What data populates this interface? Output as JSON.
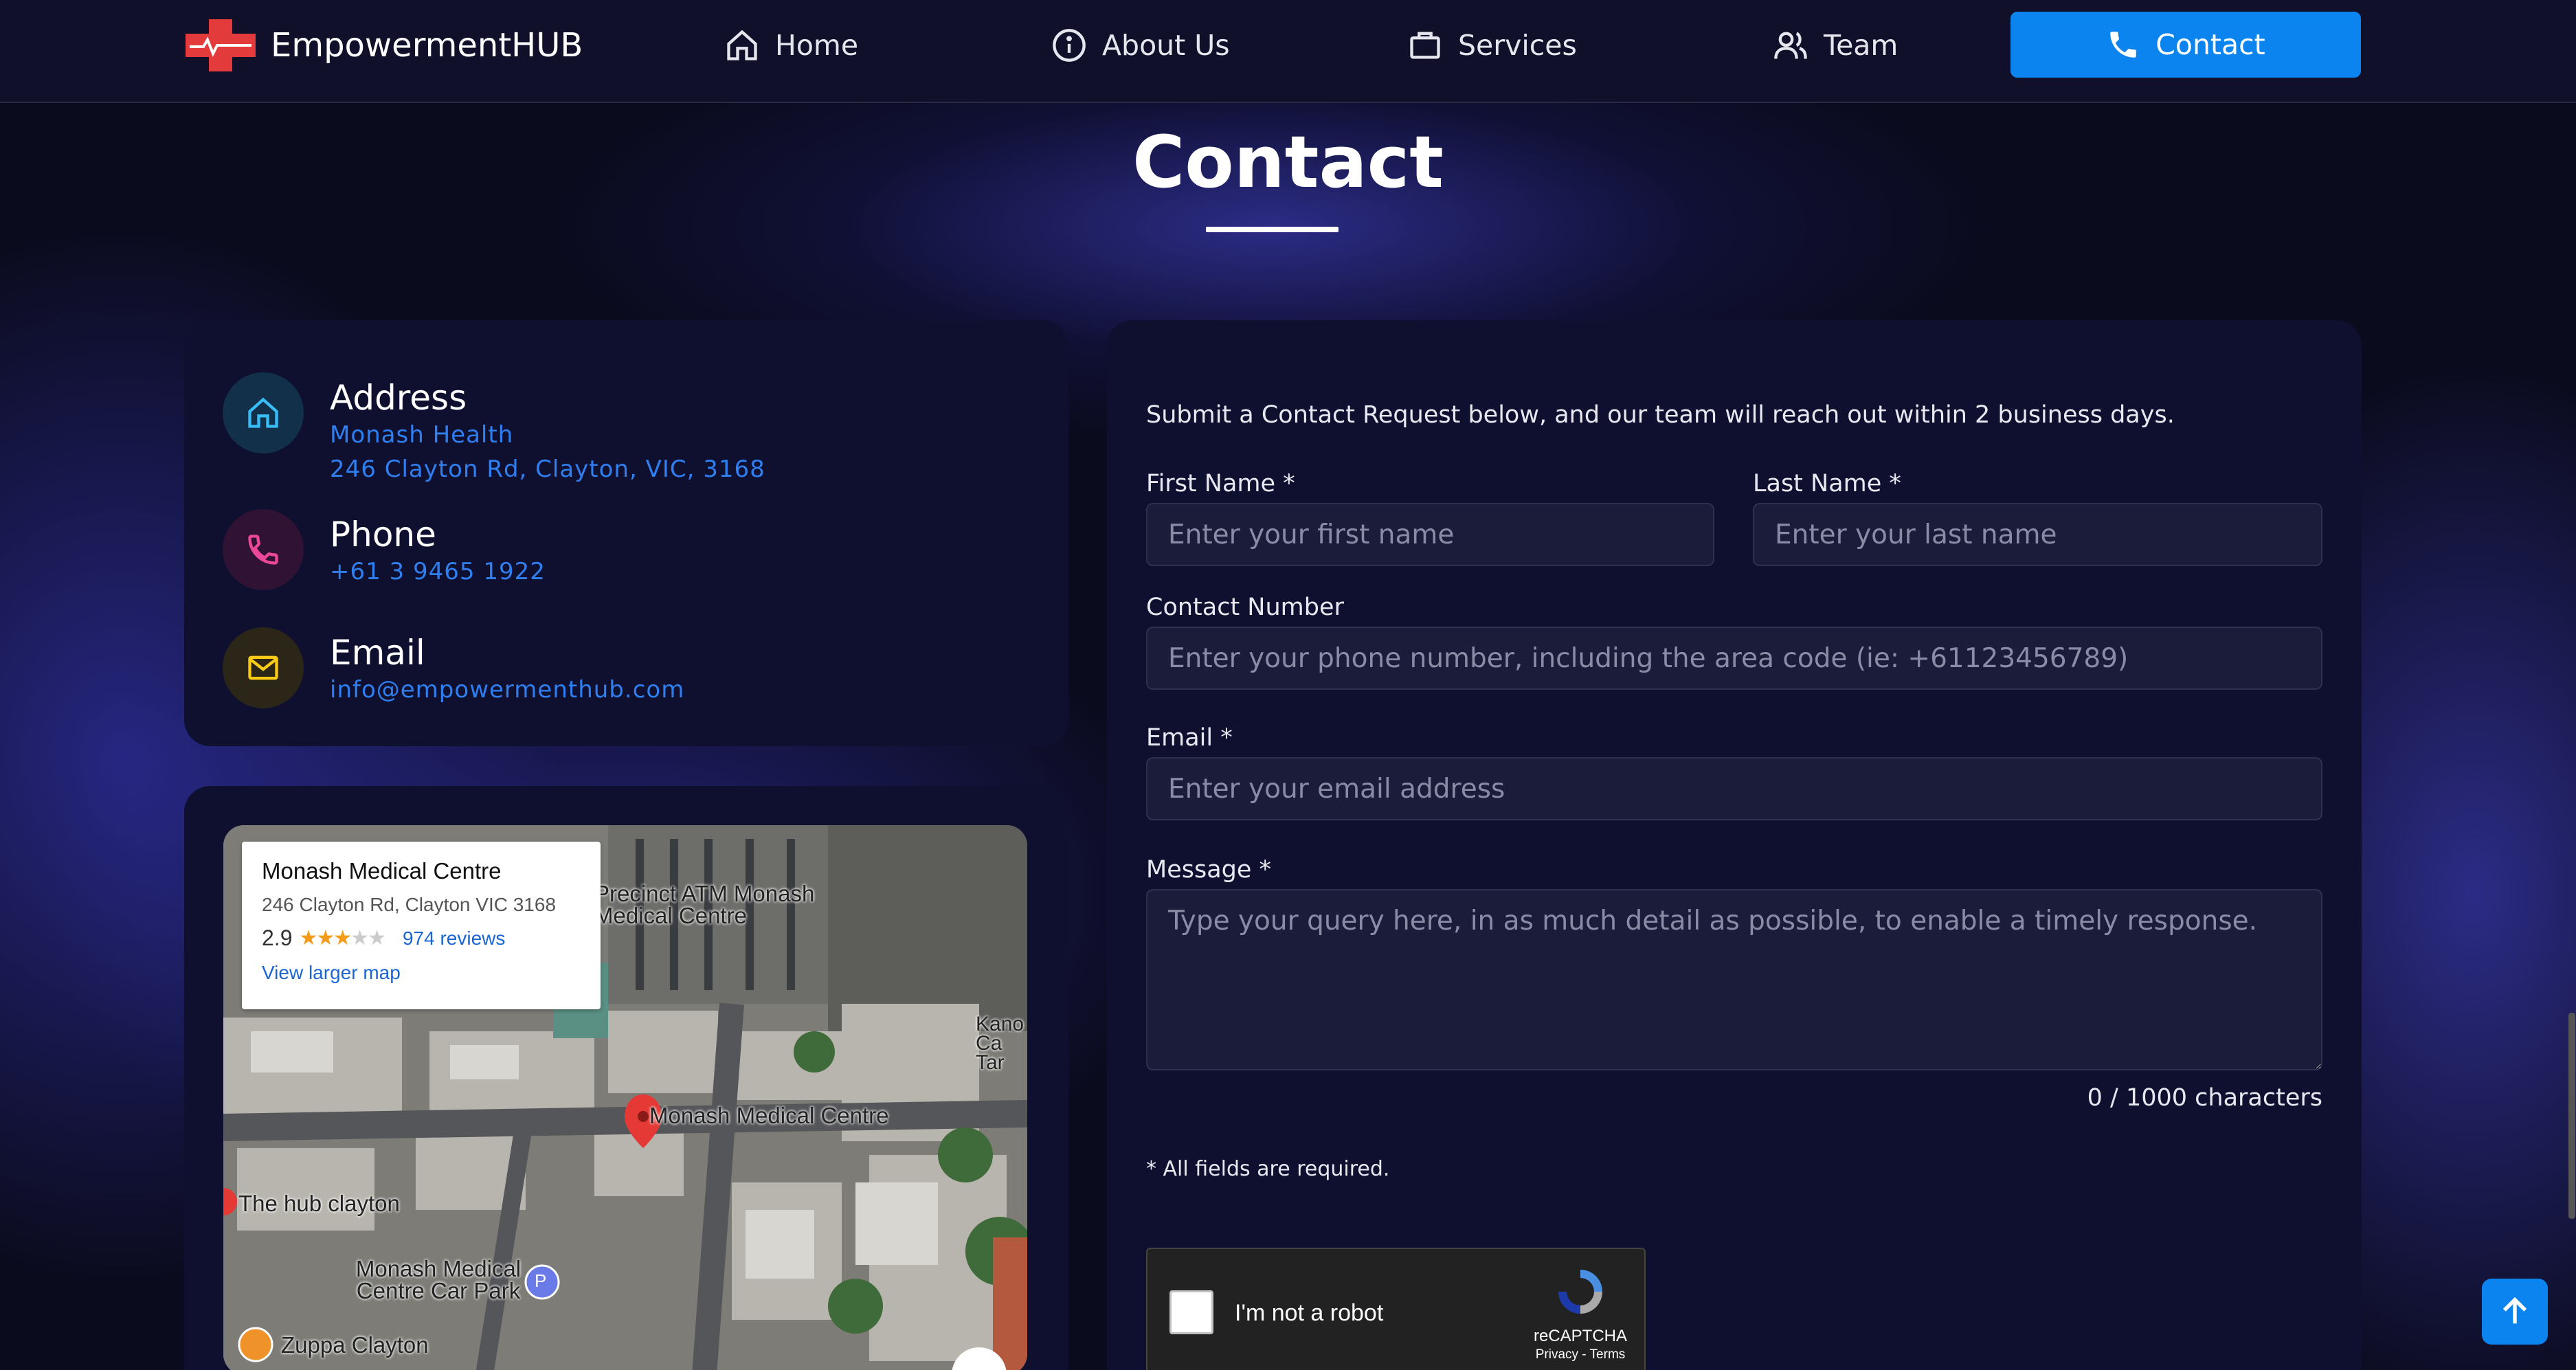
{
  "brand": {
    "name": "EmpowermentHUB"
  },
  "nav": {
    "items": [
      {
        "label": "Home",
        "icon": "home-icon"
      },
      {
        "label": "About Us",
        "icon": "info-icon"
      },
      {
        "label": "Services",
        "icon": "briefcase-icon"
      },
      {
        "label": "Team",
        "icon": "team-icon"
      }
    ],
    "contact": {
      "label": "Contact",
      "icon": "phone-icon"
    }
  },
  "page": {
    "title": "Contact"
  },
  "info": {
    "address": {
      "label": "Address",
      "line1": "Monash Health",
      "line2": "246 Clayton Rd, Clayton, VIC, 3168"
    },
    "phone": {
      "label": "Phone",
      "value": "+61 3 9465 1922"
    },
    "email": {
      "label": "Email",
      "value": "info@empowermenthub.com"
    }
  },
  "map": {
    "popup": {
      "title": "Monash Medical Centre",
      "address": "246 Clayton Rd, Clayton VIC 3168",
      "rating": "2.9",
      "reviews": "974 reviews",
      "larger_map": "View larger map"
    },
    "labels": {
      "atm": "Precinct ATM Monash Medical Centre",
      "pin": "Monash Medical Centre",
      "hub": "The hub clayton",
      "carpark": "Monash Medical Centre Car Park",
      "zuppa": "Zuppa Clayton",
      "kano": "Kano Ca Tar",
      "parking": "P"
    }
  },
  "form": {
    "intro": "Submit a Contact Request below, and our team will reach out within 2 business days.",
    "first_name": {
      "label": "First Name *",
      "placeholder": "Enter your first name"
    },
    "last_name": {
      "label": "Last Name *",
      "placeholder": "Enter your last name"
    },
    "contact_number": {
      "label": "Contact Number",
      "placeholder": "Enter your phone number, including the area code (ie: +61123456789)"
    },
    "email": {
      "label": "Email *",
      "placeholder": "Enter your email address"
    },
    "message": {
      "label": "Message *",
      "placeholder": "Type your query here, in as much detail as possible, to enable a timely response."
    },
    "char_count": "0 / 1000 characters",
    "required_note": "* All fields are required.",
    "captcha": {
      "label": "I'm not a robot",
      "brand": "reCAPTCHA",
      "links": "Privacy - Terms"
    }
  },
  "colors": {
    "accent": "#0b84f0",
    "link": "#2f7ff0",
    "card": "#0f1030"
  }
}
